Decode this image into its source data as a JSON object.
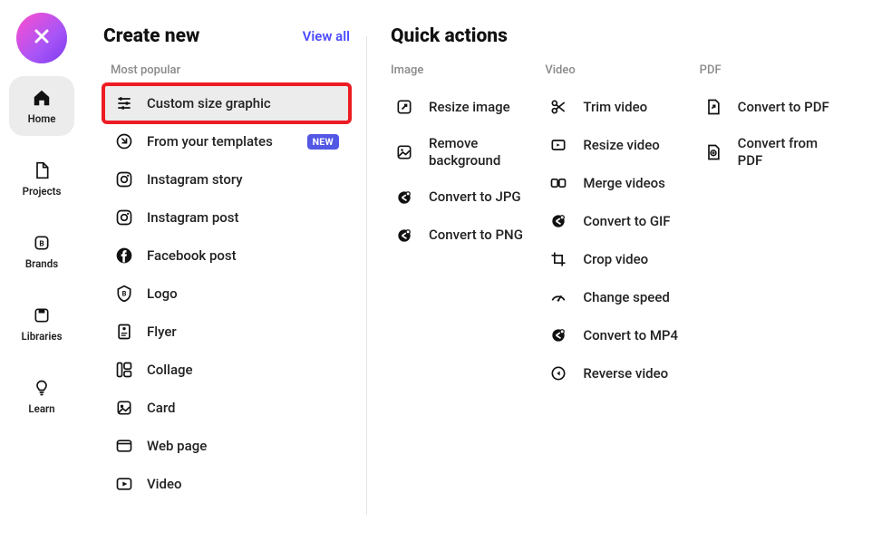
{
  "sidebar": {
    "items": [
      {
        "label": "Home"
      },
      {
        "label": "Projects"
      },
      {
        "label": "Brands"
      },
      {
        "label": "Libraries"
      },
      {
        "label": "Learn"
      }
    ]
  },
  "create": {
    "title": "Create new",
    "view_all": "View all",
    "subhead": "Most popular",
    "items": [
      {
        "label": "Custom size graphic",
        "highlight": true
      },
      {
        "label": "From your templates",
        "badge": "NEW"
      },
      {
        "label": "Instagram story"
      },
      {
        "label": "Instagram post"
      },
      {
        "label": "Facebook post"
      },
      {
        "label": "Logo"
      },
      {
        "label": "Flyer"
      },
      {
        "label": "Collage"
      },
      {
        "label": "Card"
      },
      {
        "label": "Web page"
      },
      {
        "label": "Video"
      }
    ]
  },
  "quick": {
    "title": "Quick actions",
    "columns": [
      {
        "head": "Image",
        "items": [
          {
            "label": "Resize image"
          },
          {
            "label": "Remove background"
          },
          {
            "label": "Convert to JPG"
          },
          {
            "label": "Convert to PNG"
          }
        ]
      },
      {
        "head": "Video",
        "items": [
          {
            "label": "Trim video"
          },
          {
            "label": "Resize video"
          },
          {
            "label": "Merge videos"
          },
          {
            "label": "Convert to GIF"
          },
          {
            "label": "Crop video"
          },
          {
            "label": "Change speed"
          },
          {
            "label": "Convert to MP4"
          },
          {
            "label": "Reverse video"
          }
        ]
      },
      {
        "head": "PDF",
        "items": [
          {
            "label": "Convert to PDF"
          },
          {
            "label": "Convert from PDF"
          }
        ]
      }
    ]
  }
}
